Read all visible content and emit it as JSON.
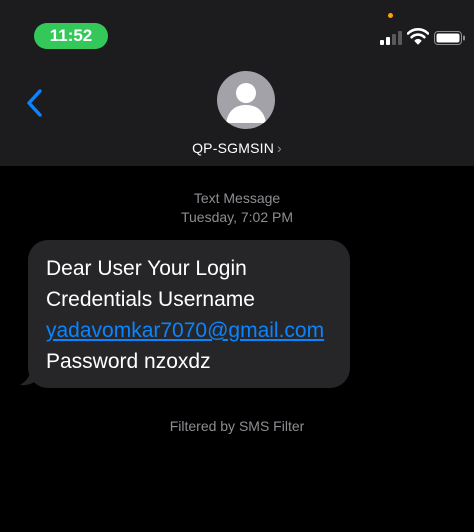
{
  "status_bar": {
    "time": "11:52",
    "pill_color": "#34c759",
    "icons": [
      "cellular-signal-icon",
      "wifi-icon",
      "battery-icon"
    ]
  },
  "header": {
    "back_icon": "chevron-left-icon",
    "contact_name": "QP-SGMSIN",
    "contact_chevron": "›"
  },
  "conversation": {
    "message_type": "Text Message",
    "timestamp": "Tuesday, 7:02 PM",
    "message": {
      "line1": "Dear User Your Login",
      "line2": "Credentials Username",
      "email_link": "yadavomkar7070@gmail.com",
      "line4": "Password nzoxdz"
    },
    "filter_note": "Filtered by SMS Filter"
  },
  "colors": {
    "accent_blue": "#0a84ff",
    "bubble": "#262628",
    "header_bg": "#1c1c1e",
    "secondary_text": "#8e8e93"
  }
}
